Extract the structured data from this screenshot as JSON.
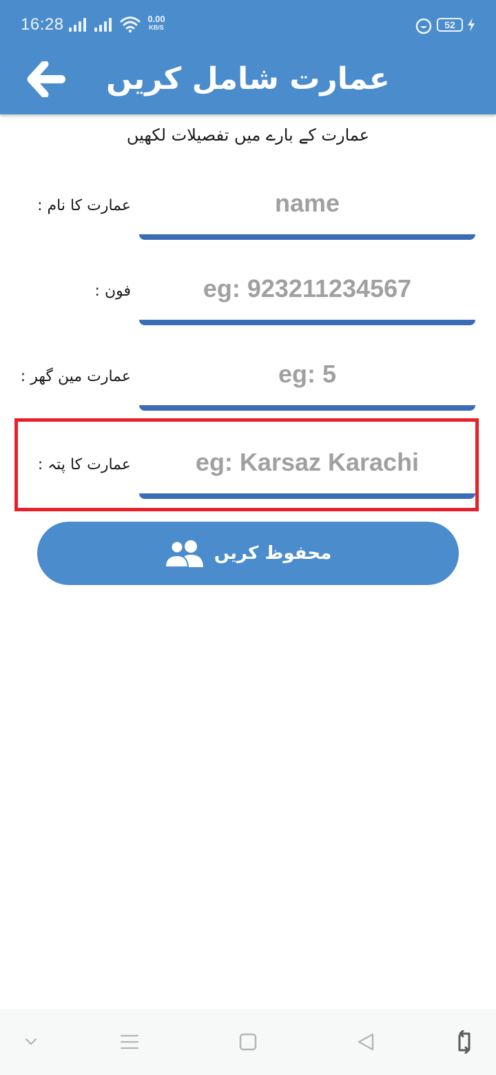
{
  "status_bar": {
    "time": "16:28",
    "net_speed_value": "0.00",
    "net_speed_unit": "KB/S",
    "battery": "52",
    "icons": [
      "signal-icon",
      "signal-icon",
      "wifi-icon",
      "app-status-icon",
      "battery-icon",
      "charging-icon"
    ]
  },
  "app_bar": {
    "title": "عمارت شامل کریں",
    "back_icon": "arrow-left-icon"
  },
  "form": {
    "subtitle": "عمارت کے بارے میں تفصیلات لکھیں",
    "fields": [
      {
        "label": "عمارت کا نام :",
        "placeholder": "name"
      },
      {
        "label": "فون :",
        "placeholder": "eg: 923211234567"
      },
      {
        "label": "عمارت مین گھر :",
        "placeholder": "eg: 5"
      },
      {
        "label": "عمارت کا پتہ :",
        "placeholder": "eg: Karsaz Karachi"
      }
    ],
    "save_button": {
      "label": "محفوظ کریں",
      "icon": "users-icon"
    }
  },
  "nav_bar": {
    "icons": [
      "chevron-down-icon",
      "menu-icon",
      "home-square-icon",
      "back-triangle-icon",
      "rotate-icon"
    ]
  },
  "colors": {
    "primary": "#4b8ccd",
    "underline": "#3a6db5",
    "placeholder": "#a0a0a0",
    "highlight": "#e8202a"
  }
}
